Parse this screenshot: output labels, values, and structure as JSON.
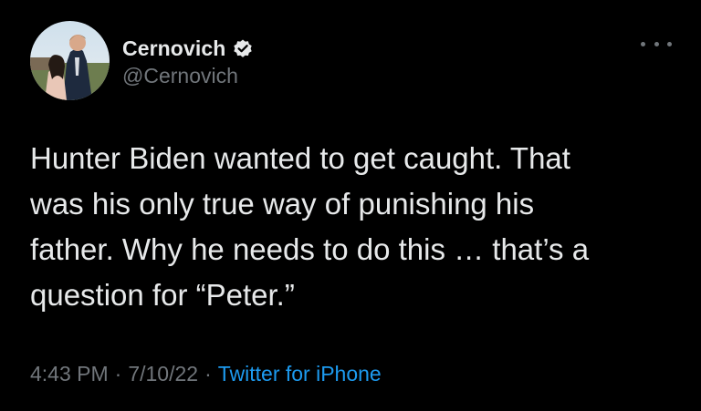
{
  "author": {
    "display_name": "Cernovich",
    "handle": "@Cernovich",
    "verified": true
  },
  "tweet": {
    "text": "Hunter Biden wanted to get caught. That\nwas his only true way of punishing his\nfather. Why he needs to do this … that’s a\nquestion for “Peter.”",
    "time": "4:43 PM",
    "separator": "·",
    "date": "7/10/22",
    "source": "Twitter for iPhone"
  },
  "colors": {
    "background": "#000000",
    "text": "#e7e9ea",
    "secondary": "#71767b",
    "link": "#1d9bf0",
    "verified_badge": "#e7e9ea"
  },
  "icons": {
    "verified": "verified-badge-icon",
    "more": "more-options-icon"
  }
}
